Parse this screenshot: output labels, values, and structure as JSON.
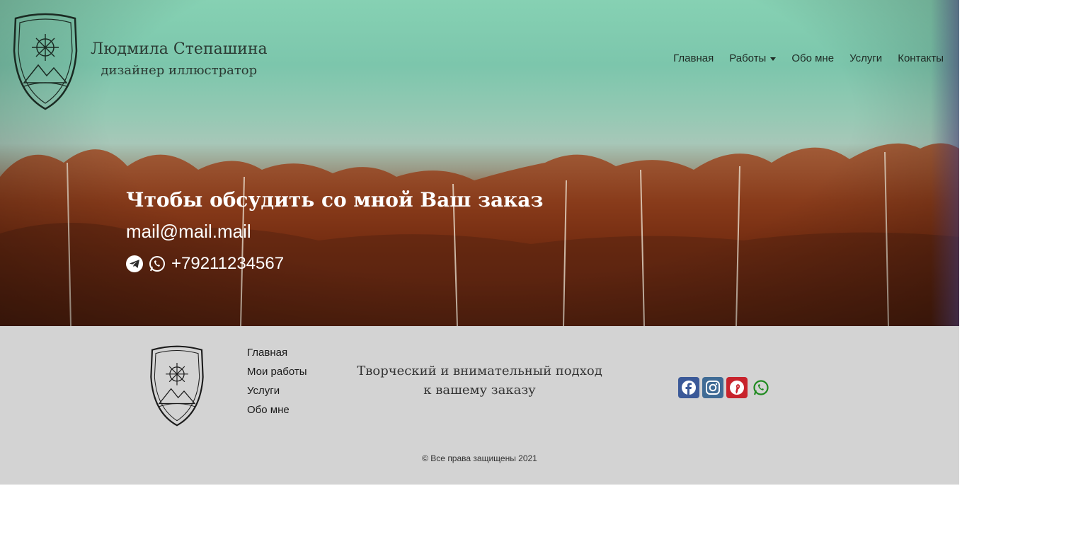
{
  "header": {
    "name": "Людмила Степашина",
    "subtitle": "дизайнер иллюстратор",
    "nav": [
      "Главная",
      "Работы",
      "Обо мне",
      "Услуги",
      "Контакты"
    ]
  },
  "contact": {
    "title": "Чтобы обсудить со мной Ваш заказ",
    "email": "mail@mail.mail",
    "phone": "+79211234567"
  },
  "footer": {
    "links": [
      "Главная",
      "Мои работы",
      "Услуги",
      "Обо мне"
    ],
    "tagline_line1": "Творческий и внимательный подход",
    "tagline_line2": "к вашему заказу",
    "socials": [
      "facebook-icon",
      "instagram-icon",
      "pinterest-icon",
      "whatsapp-icon"
    ],
    "copyright": "© Все права защищены 2021"
  },
  "colors": {
    "footer_bg": "#d3d3d3",
    "facebook": "#3b5998",
    "instagram": "#3f6b95",
    "pinterest": "#c8232c",
    "whatsapp": "#1f8a1f"
  }
}
